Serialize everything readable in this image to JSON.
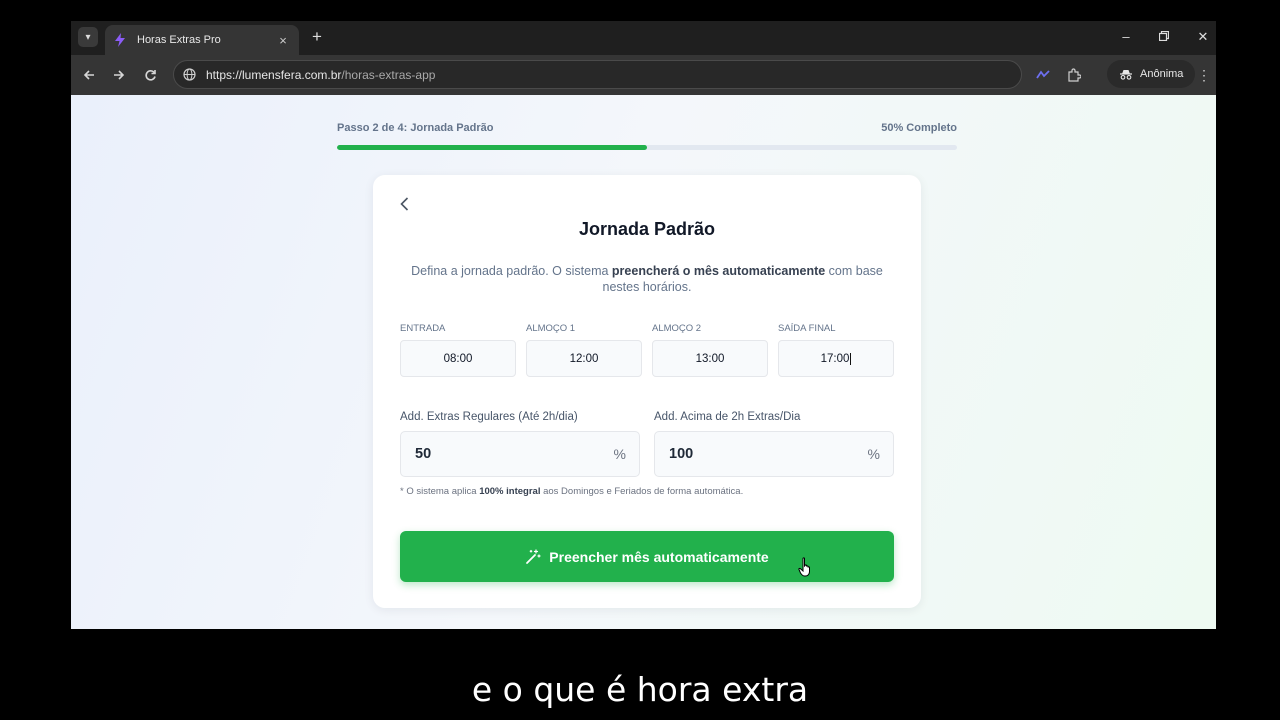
{
  "browser": {
    "tab_title": "Horas Extras Pro",
    "new_tab_label": "+",
    "url_main": "https://lumensfera.com.br",
    "url_path": "/horas-extras-app",
    "incognito_label": "Anônima",
    "icons": [
      "tab-search-icon",
      "bolt-favicon-icon",
      "close-icon",
      "back-icon",
      "forward-icon",
      "reload-icon",
      "site-info-icon",
      "extensions-icon",
      "incognito-icon",
      "menu-icon",
      "minimize-icon",
      "restore-icon",
      "window-close-icon"
    ]
  },
  "progress": {
    "step_label": "Passo 2 de 4: Jornada Padrão",
    "percent_label": "50% Completo",
    "fraction": 0.5,
    "fill_color": "#22b14c"
  },
  "card": {
    "title": "Jornada Padrão",
    "desc_before": "Defina a jornada padrão. O sistema ",
    "desc_bold": "preencherá o mês automaticamente",
    "desc_after": " com base nestes horários.",
    "times": [
      {
        "label": "Entrada",
        "value": "08:00"
      },
      {
        "label": "Almoço 1",
        "value": "12:00"
      },
      {
        "label": "Almoço 2",
        "value": "13:00"
      },
      {
        "label": "Saída Final",
        "value": "17:00"
      }
    ],
    "extras": [
      {
        "label": "Add. Extras Regulares (Até 2h/dia)",
        "value": "50",
        "unit": "%"
      },
      {
        "label": "Add. Acima de 2h Extras/Dia",
        "value": "100",
        "unit": "%"
      }
    ],
    "note_before": "* O sistema aplica ",
    "note_bold": "100% integral",
    "note_after": " aos Domingos e Feriados de forma automática.",
    "cta_label": "Preencher mês automaticamente",
    "accent": "#22b14c"
  },
  "subtitle": "e o que é hora extra"
}
